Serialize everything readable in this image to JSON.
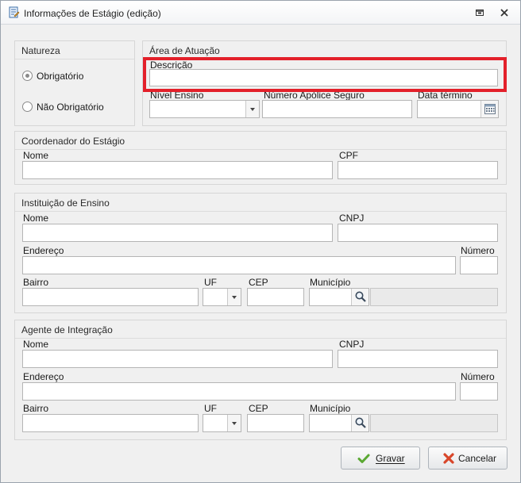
{
  "window": {
    "title": "Informações de Estágio (edição)"
  },
  "natureza": {
    "title": "Natureza",
    "options": [
      {
        "label": "Obrigatório",
        "checked": true
      },
      {
        "label": "Não Obrigatório",
        "checked": false
      }
    ]
  },
  "area": {
    "title": "Área de Atuação",
    "descricao_label": "Descrição",
    "nivel_label": "Nível Ensino",
    "apolice_label": "Número Apólice Seguro",
    "data_label": "Data término"
  },
  "coordenador": {
    "title": "Coordenador do Estágio",
    "nome_label": "Nome",
    "cpf_label": "CPF"
  },
  "instituicao": {
    "title": "Instituição de Ensino",
    "nome_label": "Nome",
    "cnpj_label": "CNPJ",
    "endereco_label": "Endereço",
    "numero_label": "Número",
    "bairro_label": "Bairro",
    "uf_label": "UF",
    "cep_label": "CEP",
    "municipio_label": "Município"
  },
  "agente": {
    "title": "Agente de Integração",
    "nome_label": "Nome",
    "cnpj_label": "CNPJ",
    "endereco_label": "Endereço",
    "numero_label": "Número",
    "bairro_label": "Bairro",
    "uf_label": "UF",
    "cep_label": "CEP",
    "municipio_label": "Município"
  },
  "actions": {
    "gravar_label": "Gravar",
    "cancelar_label": "Cancelar"
  },
  "colors": {
    "highlight": "#e3202a",
    "gravar_icon": "#5aa832",
    "cancelar_icon": "#d8462a"
  },
  "icons": [
    "form-icon",
    "restore-icon",
    "close-icon",
    "calendar-icon",
    "search-icon",
    "check-icon",
    "x-icon",
    "chevron-down-icon"
  ]
}
